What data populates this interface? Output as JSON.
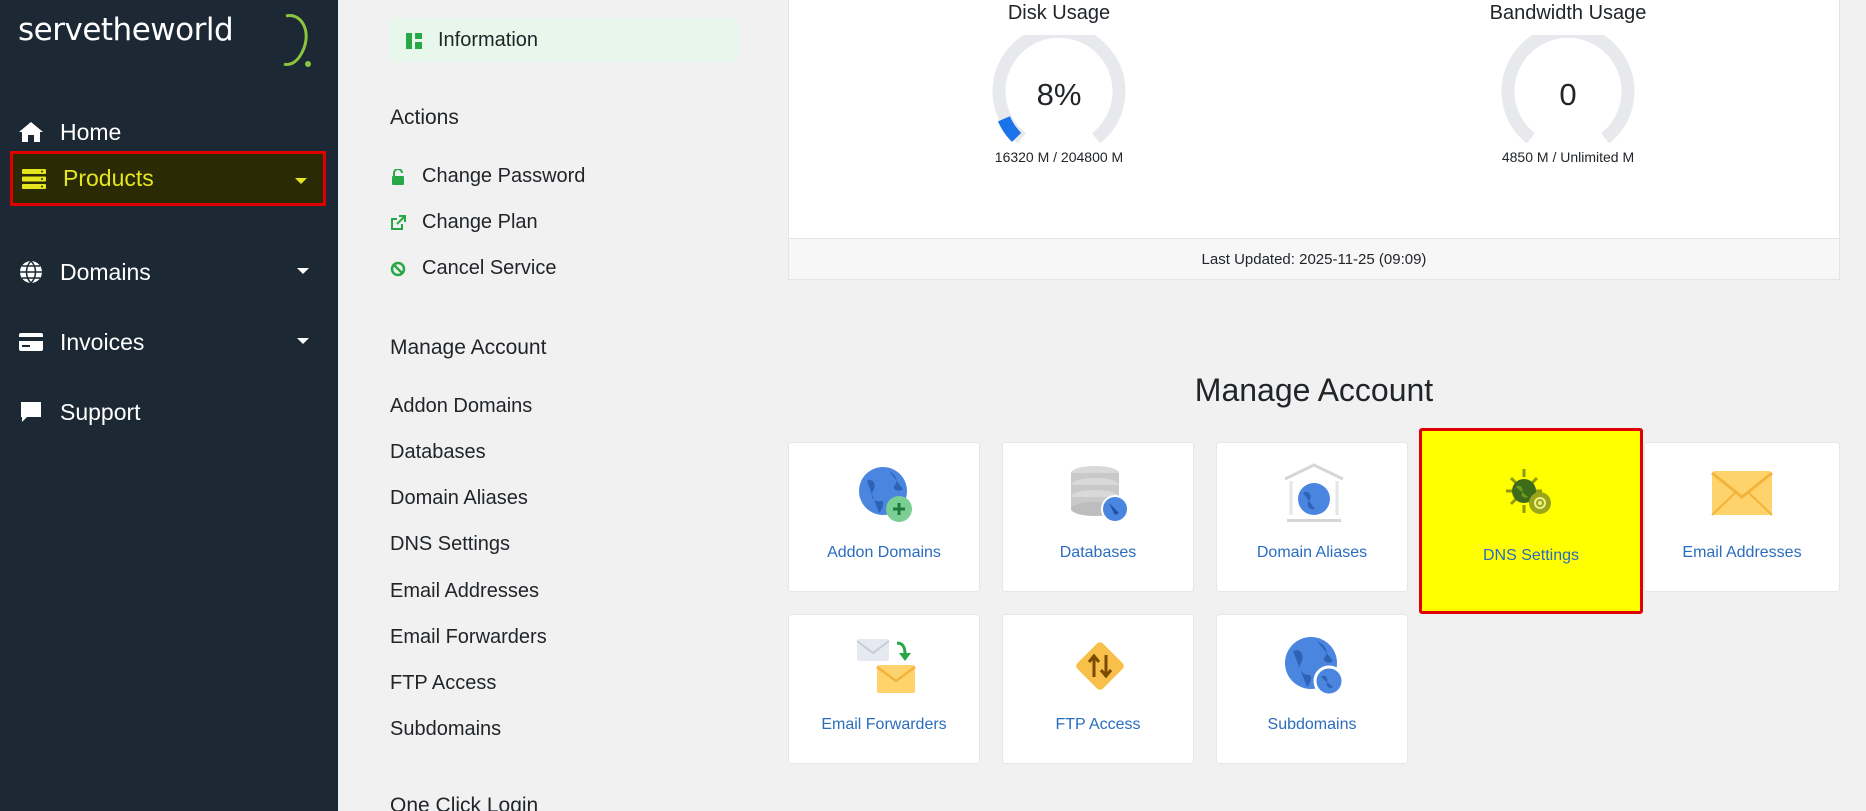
{
  "brand": {
    "logo_text": "servetheworld"
  },
  "sidebar": {
    "items": [
      {
        "label": "Home",
        "icon": "home-icon"
      },
      {
        "label": "Products",
        "icon": "server-icon",
        "active": true
      },
      {
        "label": "Domains",
        "icon": "globe-icon"
      },
      {
        "label": "Invoices",
        "icon": "credit-card-icon"
      },
      {
        "label": "Support",
        "icon": "comment-icon"
      }
    ]
  },
  "middle": {
    "info_tab": "Information",
    "actions_title": "Actions",
    "actions": [
      {
        "label": "Change Password",
        "icon": "lock-icon"
      },
      {
        "label": "Change Plan",
        "icon": "external-link-icon"
      },
      {
        "label": "Cancel Service",
        "icon": "ban-icon"
      }
    ],
    "manage_title": "Manage Account",
    "manage_links": [
      "Addon Domains",
      "Databases",
      "Domain Aliases",
      "DNS Settings",
      "Email Addresses",
      "Email Forwarders",
      "FTP Access",
      "Subdomains"
    ],
    "one_click_title": "One Click Login"
  },
  "usage": {
    "disk": {
      "title": "Disk Usage",
      "value": "8%",
      "percent": 8,
      "detail": "16320 M / 204800 M"
    },
    "bandwidth": {
      "title": "Bandwidth Usage",
      "value": "0",
      "percent": 0,
      "detail": "4850 M / Unlimited M"
    },
    "last_updated": "Last Updated: 2025-11-25 (09:09)"
  },
  "manage_account": {
    "title": "Manage Account",
    "tiles": [
      {
        "label": "Addon Domains",
        "icon": "addon-domains-icon"
      },
      {
        "label": "Databases",
        "icon": "databases-icon"
      },
      {
        "label": "Domain Aliases",
        "icon": "domain-aliases-icon"
      },
      {
        "label": "DNS Settings",
        "icon": "dns-settings-icon",
        "highlighted": true
      },
      {
        "label": "Email Addresses",
        "icon": "email-addresses-icon"
      },
      {
        "label": "Email Forwarders",
        "icon": "email-forwarders-icon"
      },
      {
        "label": "FTP Access",
        "icon": "ftp-access-icon"
      },
      {
        "label": "Subdomains",
        "icon": "subdomains-icon"
      }
    ]
  },
  "colors": {
    "sidebar_bg": "#1c2833",
    "active_text": "#e6e61e",
    "highlight_border": "#e00000",
    "highlight_fill": "#ffff00",
    "link_blue": "#2a6cbf",
    "accent_green": "#27a745",
    "gauge_blue": "#1a73e8"
  }
}
